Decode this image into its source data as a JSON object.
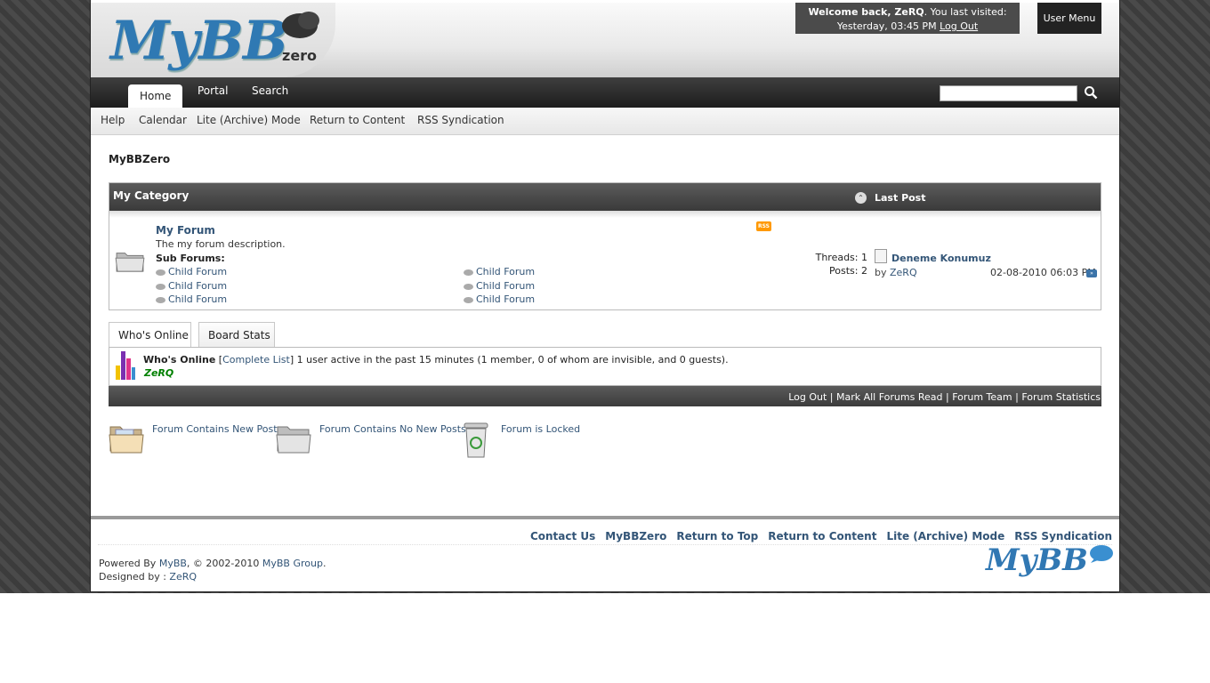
{
  "header": {
    "logo_text": "MyBB",
    "logo_sub": "zero",
    "welcome_bold": "Welcome back, ZeRQ",
    "welcome_rest": ". You last visited:",
    "last_visit": "Yesterday, 03:45 PM",
    "logout": "Log Out",
    "user_menu": "User Menu"
  },
  "nav": {
    "tabs": [
      {
        "label": "Home"
      },
      {
        "label": "Portal"
      },
      {
        "label": "Search"
      }
    ],
    "search_value": ""
  },
  "subnav": {
    "items": [
      {
        "label": "Help"
      },
      {
        "label": "Calendar"
      },
      {
        "label": "Lite (Archive) Mode"
      },
      {
        "label": "Return to Content"
      },
      {
        "label": "RSS Syndication"
      }
    ]
  },
  "breadcrumb": "MyBBZero",
  "category": {
    "title": "My Category",
    "last_post_header": "Last Post",
    "forum": {
      "name": "My Forum",
      "description": "The my forum description.",
      "sub_header": "Sub Forums:",
      "subforums": [
        "Child Forum",
        "Child Forum",
        "Child Forum",
        "Child Forum",
        "Child Forum",
        "Child Forum"
      ],
      "threads_label": "Threads:",
      "threads": "1",
      "posts_label": "Posts:",
      "posts": "2",
      "rss": "RSS",
      "last_post": {
        "title": "Deneme Konumuz",
        "by": "by ",
        "author": "ZeRQ",
        "date": "02-08-2010 06:03 PM"
      }
    }
  },
  "stats_tabs": [
    {
      "label": "Who's Online"
    },
    {
      "label": "Board Stats"
    }
  ],
  "whos_online": {
    "title": "Who's Online",
    "bracket_open": "[",
    "complete_list": "Complete List",
    "bracket_close": "]",
    "summary": "1 user active in the past 15 minutes (1 member, 0 of whom are invisible, and 0 guests).",
    "user": "ZeRQ"
  },
  "bottom_links": {
    "logout": "Log Out",
    "mark_read": "Mark All Forums Read",
    "forum_team": "Forum Team",
    "forum_stats": "Forum Statistics",
    "sep": " | "
  },
  "legend": {
    "new_posts": "Forum Contains New Posts",
    "no_new_posts": "Forum Contains No New Posts",
    "locked": "Forum is Locked"
  },
  "footer": {
    "links": [
      {
        "label": "Contact Us"
      },
      {
        "label": "MyBBZero"
      },
      {
        "label": "Return to Top"
      },
      {
        "label": "Return to Content"
      },
      {
        "label": "Lite (Archive) Mode"
      },
      {
        "label": "RSS Syndication"
      }
    ],
    "powered_prefix": "Powered By ",
    "powered_mybb": "MyBB",
    "powered_mid": ", © 2002-2010 ",
    "powered_group": "MyBB Group",
    "powered_end": ".",
    "designed_prefix": "Designed by : ",
    "designer": "ZeRQ",
    "logo_text": "MyBB"
  },
  "colors": {
    "link": "#335577",
    "dark_bar": "#3a3a3a",
    "online_user": "#008000"
  }
}
